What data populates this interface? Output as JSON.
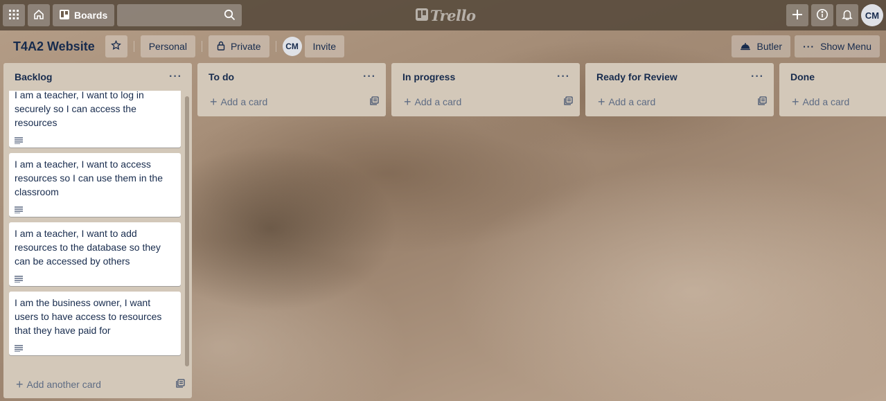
{
  "topbar": {
    "boards_label": "Boards",
    "search_placeholder": "",
    "logo_text": "Trello",
    "avatar_initials": "CM",
    "icons": [
      "apps-grid-icon",
      "home-icon",
      "boards-icon",
      "search-icon",
      "plus-icon",
      "info-icon",
      "bell-icon"
    ]
  },
  "board": {
    "title": "T4A2 Website",
    "team_label": "Personal",
    "visibility_label": "Private",
    "member_initials": "CM",
    "invite_label": "Invite",
    "butler_label": "Butler",
    "show_menu_label": "Show Menu"
  },
  "lists": [
    {
      "title": "Backlog",
      "add_label": "Add another card",
      "cards": [
        {
          "text": "I am a teacher, I want to log in securely so I can access the resources",
          "has_description": true
        },
        {
          "text": "I am a teacher, I want to access resources so I can use them in the classroom",
          "has_description": true
        },
        {
          "text": "I am a teacher, I want to add resources to the database so they can be accessed by others",
          "has_description": true
        },
        {
          "text": "I am the business owner, I want users to have access to resources that they have paid for",
          "has_description": true
        }
      ]
    },
    {
      "title": "To do",
      "add_label": "Add a card",
      "cards": []
    },
    {
      "title": "In progress",
      "add_label": "Add a card",
      "cards": []
    },
    {
      "title": "Ready for Review",
      "add_label": "Add a card",
      "cards": []
    },
    {
      "title": "Done",
      "add_label": "Add a card",
      "cards": []
    }
  ],
  "colors": {
    "topbar_bg": "#54463a",
    "list_bg": "#d3c8b9",
    "card_bg": "#ffffff",
    "text_primary": "#172b4d",
    "text_muted": "#5e6c84"
  }
}
